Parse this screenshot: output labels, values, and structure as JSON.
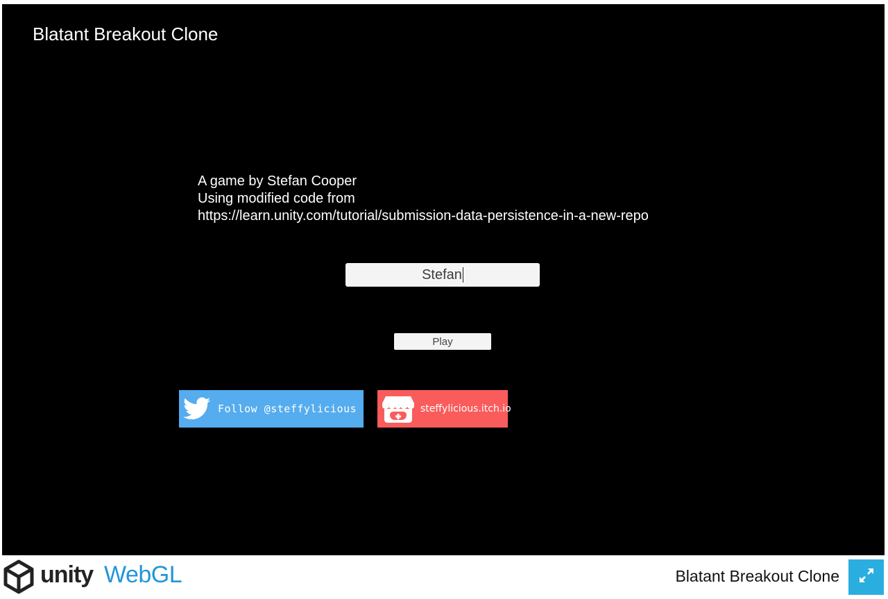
{
  "game": {
    "title": "Blatant Breakout Clone",
    "credits": {
      "line1": "A game by Stefan Cooper",
      "line2": "Using modified code from",
      "line3": "https://learn.unity.com/tutorial/submission-data-persistence-in-a-new-repo"
    },
    "name_input": {
      "value": "Stefan"
    },
    "play_label": "Play",
    "twitter": {
      "label": "Follow @steffylicious",
      "icon": "twitter-bird-icon",
      "color": "#55acee"
    },
    "itch": {
      "label": "steffylicious.itch.io",
      "icon": "itch-io-icon",
      "color": "#fa5c5c"
    }
  },
  "footer": {
    "logo_icon": "unity-logo-icon",
    "unity_label": "unity",
    "webgl_label": "WebGL",
    "webgl_color": "#2196d8",
    "title": "Blatant Breakout Clone",
    "fullscreen_icon": "fullscreen-icon",
    "fullscreen_color": "#2aaee0"
  }
}
